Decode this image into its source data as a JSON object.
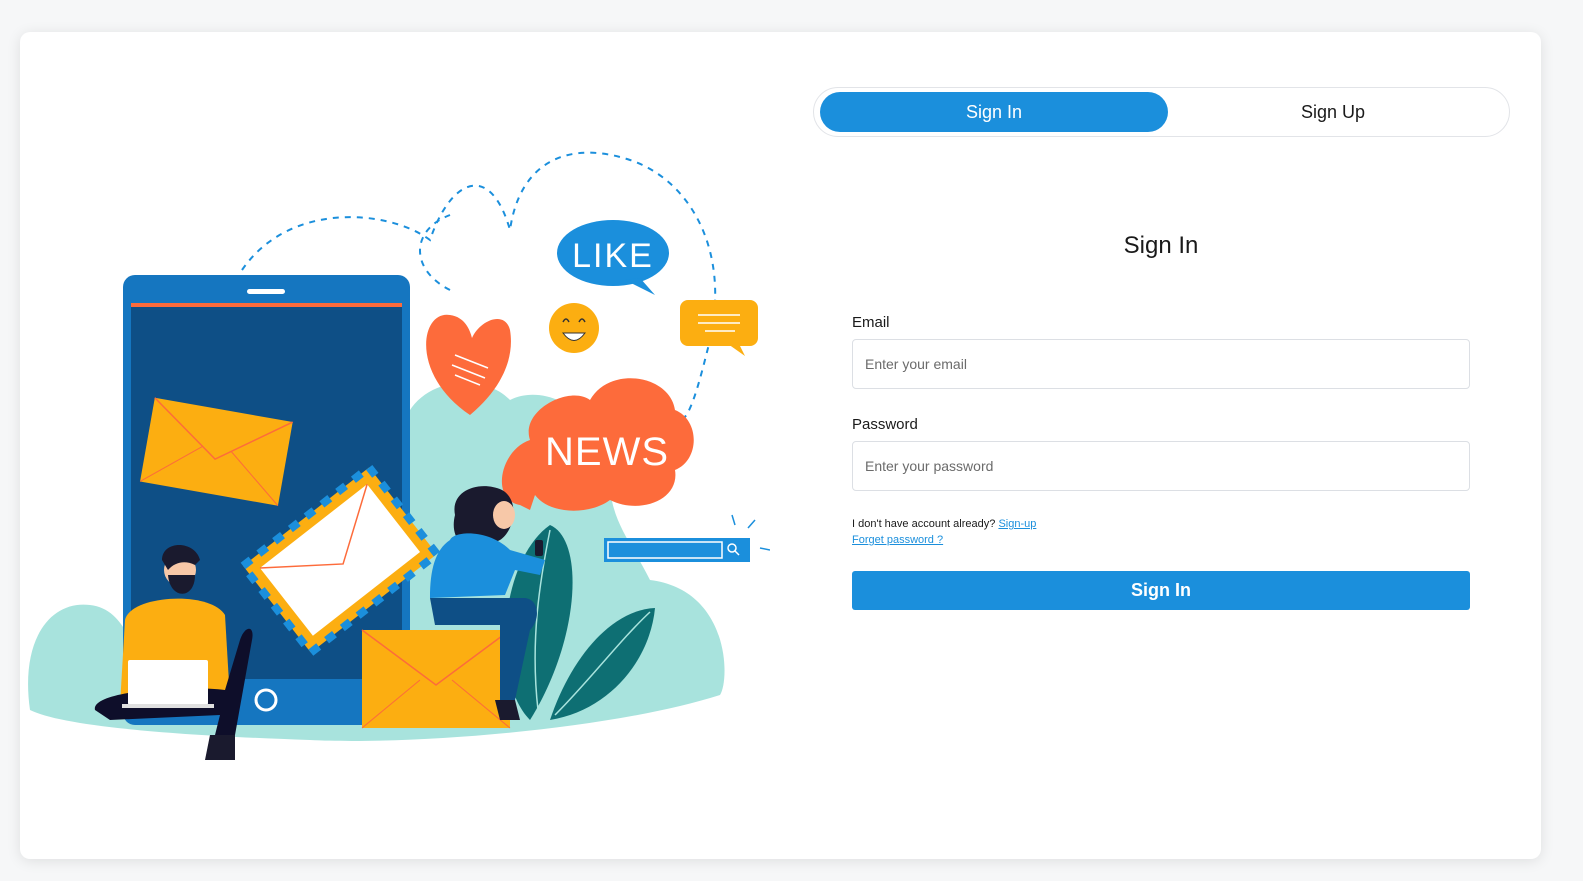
{
  "tabs": {
    "sign_in": "Sign In",
    "sign_up": "Sign Up",
    "active": "sign_in"
  },
  "form": {
    "title": "Sign In",
    "email_label": "Email",
    "email_placeholder": "Enter your email",
    "email_value": "",
    "password_label": "Password",
    "password_placeholder": "Enter your password",
    "password_value": "",
    "no_account_text": "I don't have account already?",
    "signup_link": "Sign-up",
    "forgot_link": "Forget password ?",
    "submit_label": "Sign In"
  },
  "illustration": {
    "like_text": "LIKE",
    "news_text": "NEWS"
  },
  "colors": {
    "accent": "#1b8fdc",
    "phone_frame": "#1576c0",
    "phone_screen": "#0e4f86",
    "envelope": "#fcae11",
    "coral": "#fd6b3b",
    "mint": "#a8e3dd",
    "teal_leaf": "#0e6f73"
  }
}
